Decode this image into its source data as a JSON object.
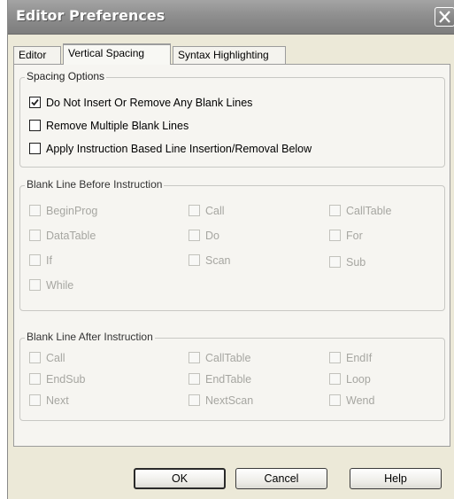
{
  "window": {
    "title": "Editor Preferences"
  },
  "tabs": [
    {
      "label": "Editor",
      "active": false
    },
    {
      "label": "Vertical Spacing",
      "active": true
    },
    {
      "label": "Syntax Highlighting",
      "active": false
    }
  ],
  "spacing_options": {
    "title": "Spacing Options",
    "items": [
      {
        "label": "Do Not Insert Or Remove Any Blank Lines",
        "checked": true
      },
      {
        "label": "Remove Multiple Blank Lines",
        "checked": false
      },
      {
        "label": "Apply Instruction Based Line Insertion/Removal Below",
        "checked": false
      }
    ]
  },
  "before_instruction": {
    "title": "Blank Line Before Instruction",
    "items": [
      {
        "label": "BeginProg",
        "checked": false
      },
      {
        "label": "Call",
        "checked": false
      },
      {
        "label": "CallTable",
        "checked": false
      },
      {
        "label": "DataTable",
        "checked": false
      },
      {
        "label": "Do",
        "checked": false
      },
      {
        "label": "For",
        "checked": false
      },
      {
        "label": "If",
        "checked": false
      },
      {
        "label": "Scan",
        "checked": false
      },
      {
        "label": "Sub",
        "checked": false
      },
      {
        "label": "While",
        "checked": false
      }
    ]
  },
  "after_instruction": {
    "title": "Blank Line After Instruction",
    "items": [
      {
        "label": "Call",
        "checked": false
      },
      {
        "label": "CallTable",
        "checked": false
      },
      {
        "label": "EndIf",
        "checked": false
      },
      {
        "label": "EndSub",
        "checked": false
      },
      {
        "label": "EndTable",
        "checked": false
      },
      {
        "label": "Loop",
        "checked": false
      },
      {
        "label": "Next",
        "checked": false
      },
      {
        "label": "NextScan",
        "checked": false
      },
      {
        "label": "Wend",
        "checked": false
      }
    ]
  },
  "buttons": {
    "ok": "OK",
    "cancel": "Cancel",
    "help": "Help"
  },
  "colors": {
    "titlebar": "#8f8f8f",
    "dialog_face": "#ece9d8",
    "disabled_text": "#a6a6a1"
  }
}
